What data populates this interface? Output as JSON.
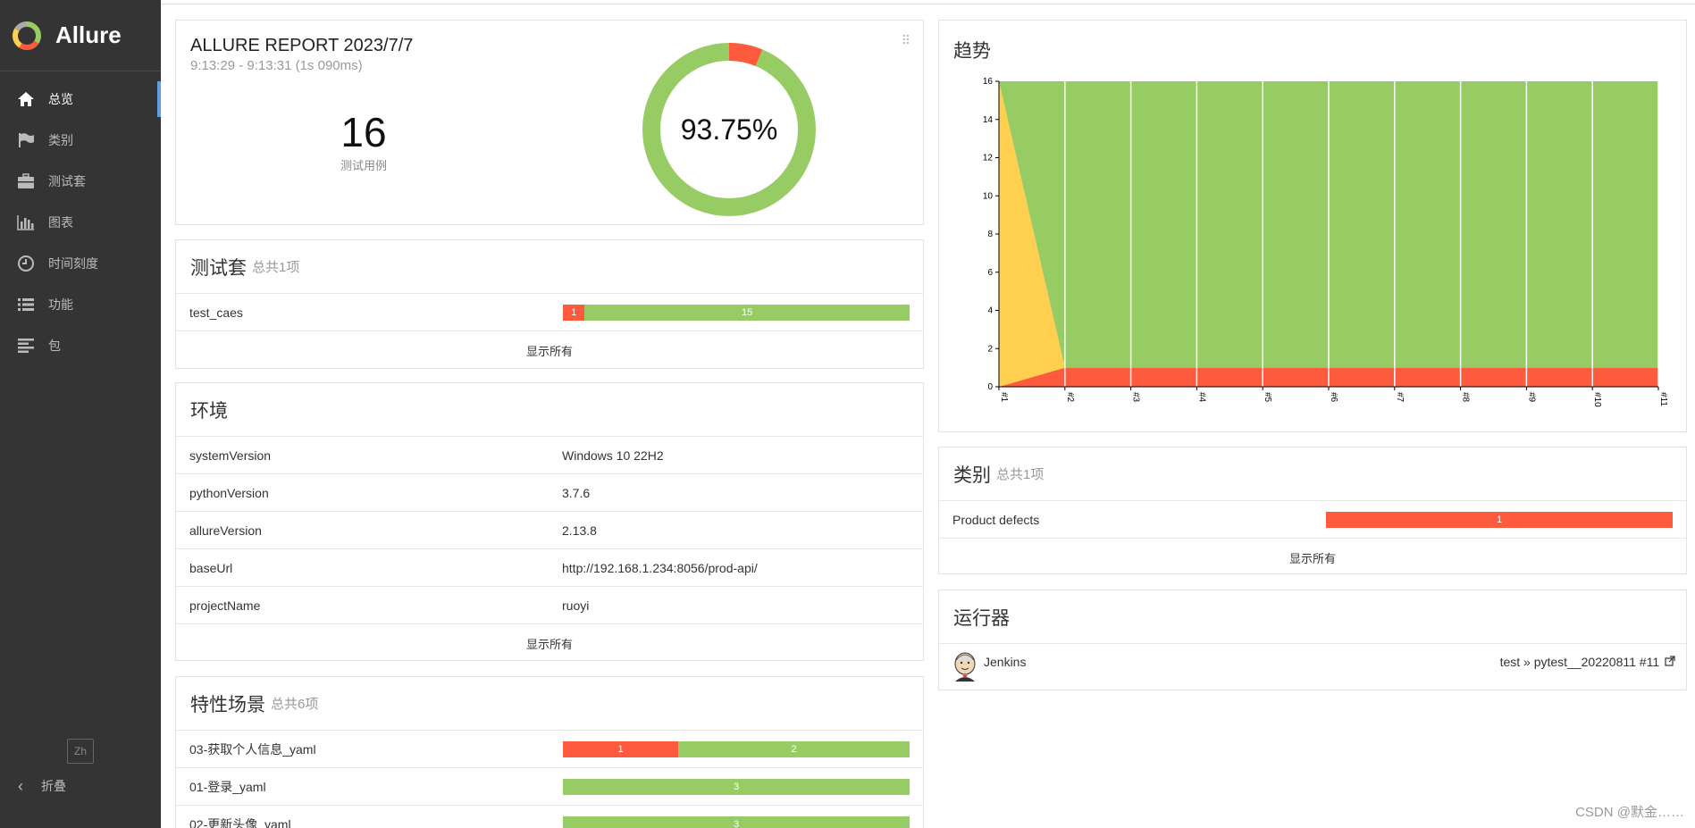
{
  "sidebar": {
    "brand": "Allure",
    "items": [
      {
        "label": "总览",
        "icon": "home-icon"
      },
      {
        "label": "类别",
        "icon": "flag-icon"
      },
      {
        "label": "测试套",
        "icon": "briefcase-icon"
      },
      {
        "label": "图表",
        "icon": "bar-chart-icon"
      },
      {
        "label": "时间刻度",
        "icon": "clock-icon"
      },
      {
        "label": "功能",
        "icon": "list-icon"
      },
      {
        "label": "包",
        "icon": "align-left-icon"
      }
    ],
    "lang": "Zh",
    "collapse": "折叠"
  },
  "summary": {
    "title": "ALLURE REPORT 2023/7/7",
    "time": "9:13:29 - 9:13:31 (1s 090ms)",
    "count": "16",
    "count_label": "测试用例",
    "percent": "93.75%",
    "failed": 1,
    "passed": 15
  },
  "suites": {
    "title": "测试套",
    "sub": "总共1项",
    "rows": [
      {
        "name": "test_caes",
        "failed": "1",
        "passed": "15"
      }
    ],
    "show_all": "显示所有"
  },
  "env": {
    "title": "环境",
    "rows": [
      {
        "k": "systemVersion",
        "v": "Windows 10 22H2"
      },
      {
        "k": "pythonVersion",
        "v": "3.7.6"
      },
      {
        "k": "allureVersion",
        "v": "2.13.8"
      },
      {
        "k": "baseUrl",
        "v": "http://192.168.1.234:8056/prod-api/"
      },
      {
        "k": "projectName",
        "v": "ruoyi"
      }
    ],
    "show_all": "显示所有"
  },
  "features": {
    "title": "特性场景",
    "sub": "总共6项",
    "rows": [
      {
        "name": "03-获取个人信息_yaml",
        "failed": "1",
        "passed": "2",
        "fail_frac": 0.333
      },
      {
        "name": "01-登录_yaml",
        "failed": "",
        "passed": "3",
        "fail_frac": 0
      },
      {
        "name": "02-更新头像_yaml",
        "failed": "",
        "passed": "3",
        "fail_frac": 0
      }
    ]
  },
  "trend": {
    "title": "趋势",
    "colors": {
      "passed": "#97cc64",
      "failed": "#fd5a3e",
      "broken": "#ffd050"
    }
  },
  "chart_data": {
    "type": "area",
    "categories": [
      "#1",
      "#2",
      "#3",
      "#4",
      "#5",
      "#6",
      "#7",
      "#8",
      "#9",
      "#10",
      "#11"
    ],
    "series": [
      {
        "values": [
          0,
          1,
          1,
          1,
          1,
          1,
          1,
          1,
          1,
          1,
          1
        ]
      },
      {
        "values": [
          16,
          0,
          0,
          0,
          0,
          0,
          0,
          0,
          0,
          0,
          0
        ]
      },
      {
        "values": [
          0,
          15,
          15,
          15,
          15,
          15,
          15,
          15,
          15,
          15,
          15
        ]
      }
    ],
    "yticks": [
      "0",
      "2",
      "4",
      "6",
      "8",
      "10",
      "12",
      "14",
      "16"
    ],
    "ylim": [
      0,
      16
    ],
    "title": "",
    "xlabel": "",
    "ylabel": ""
  },
  "categories": {
    "title": "类别",
    "sub": "总共1项",
    "rows": [
      {
        "name": "Product defects",
        "count": "1"
      }
    ],
    "show_all": "显示所有"
  },
  "executors": {
    "title": "运行器",
    "name": "Jenkins",
    "build": "test » pytest__20220811 #11"
  },
  "watermark": "CSDN @默金……"
}
